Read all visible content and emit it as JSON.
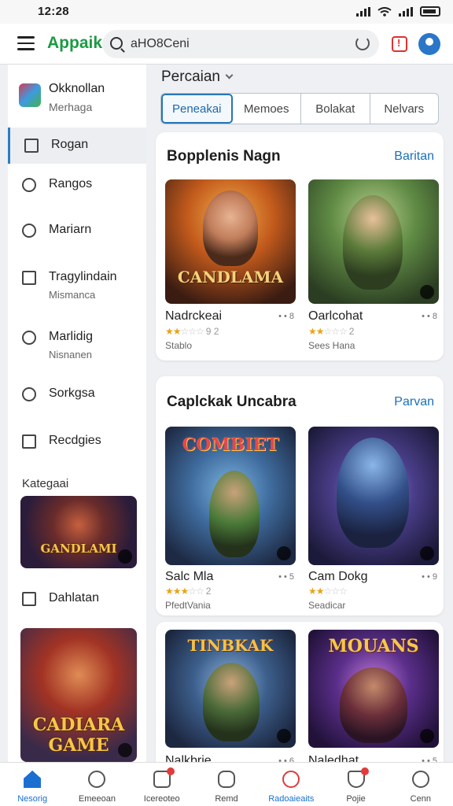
{
  "status_bar": {
    "time": "12:28"
  },
  "header": {
    "app_name": "Appaik",
    "search_value": "aHO8Ceni"
  },
  "sidebar": {
    "profile": {
      "name": "Okknollan",
      "sub": "Merhaga"
    },
    "items": [
      {
        "label": "Rogan",
        "icon": "grid-icon",
        "active": true
      },
      {
        "label": "Rangos",
        "icon": "compass-icon"
      },
      {
        "label": "Mariarn",
        "icon": "key-icon"
      },
      {
        "label": "Tragylindain",
        "sub": "Mismanca",
        "icon": "list-icon"
      },
      {
        "label": "Marlidig",
        "sub": "Nisnanen",
        "icon": "target-icon"
      },
      {
        "label": "Sorkgsa",
        "icon": "timer-icon"
      },
      {
        "label": "Recdgies",
        "icon": "square-icon"
      }
    ],
    "section_label": "Kategaai",
    "thumb1_title": "GANDLAMI",
    "after_item": {
      "label": "Dahlatan",
      "icon": "camera-icon"
    },
    "thumb2_title": "CADIARA GAME"
  },
  "main": {
    "category_title": "Percaian",
    "tabs": [
      "Peneakai",
      "Memoes",
      "Bolakat",
      "Nelvars"
    ],
    "section1": {
      "title": "Bopplenis Nagn",
      "link": "Baritan",
      "cards": [
        {
          "title": "Nadrckeai",
          "meta": "• • 8",
          "stars": 2,
          "rating": "9 2",
          "sub": "Stablo",
          "art": "CANDLAMA"
        },
        {
          "title": "Oarlcohat",
          "meta": "• • 8",
          "stars": 2,
          "rating": "2",
          "sub": "Sees Hana",
          "art": ""
        }
      ]
    },
    "section2": {
      "title": "Caplckak Uncabra",
      "link": "Parvan",
      "cards": [
        {
          "title": "Salc Mla",
          "meta": "• • 5",
          "stars": 3,
          "rating": "2",
          "sub": "PfedtVania",
          "art": "COMBIET"
        },
        {
          "title": "Cam Dokg",
          "meta": "• • 9",
          "stars": 2,
          "rating": "",
          "sub": "Seadicar",
          "art": ""
        }
      ]
    },
    "section3": {
      "cards": [
        {
          "title": "Nalkbrie",
          "meta": "• • 6",
          "art": "TINBKAK"
        },
        {
          "title": "Naledhat",
          "meta": "• • 5",
          "art": "MOUANS"
        }
      ]
    }
  },
  "bottom_nav": [
    {
      "label": "Nesorig",
      "icon": "home-icon",
      "active": true
    },
    {
      "label": "Emeeoan",
      "icon": "tools-icon"
    },
    {
      "label": "Icereoteo",
      "icon": "inbox-icon",
      "badge": true
    },
    {
      "label": "Remd",
      "icon": "gamepad-icon"
    },
    {
      "label": "Radoaieaits",
      "icon": "heart-icon",
      "highlight": true
    },
    {
      "label": "Pojie",
      "icon": "shield-icon",
      "badge": true
    },
    {
      "label": "Cenn",
      "icon": "user-icon"
    }
  ],
  "colors": {
    "accent": "#1b6fd1",
    "brand": "#1a9b43",
    "star": "#e8a41b",
    "alert": "#e0312f"
  }
}
